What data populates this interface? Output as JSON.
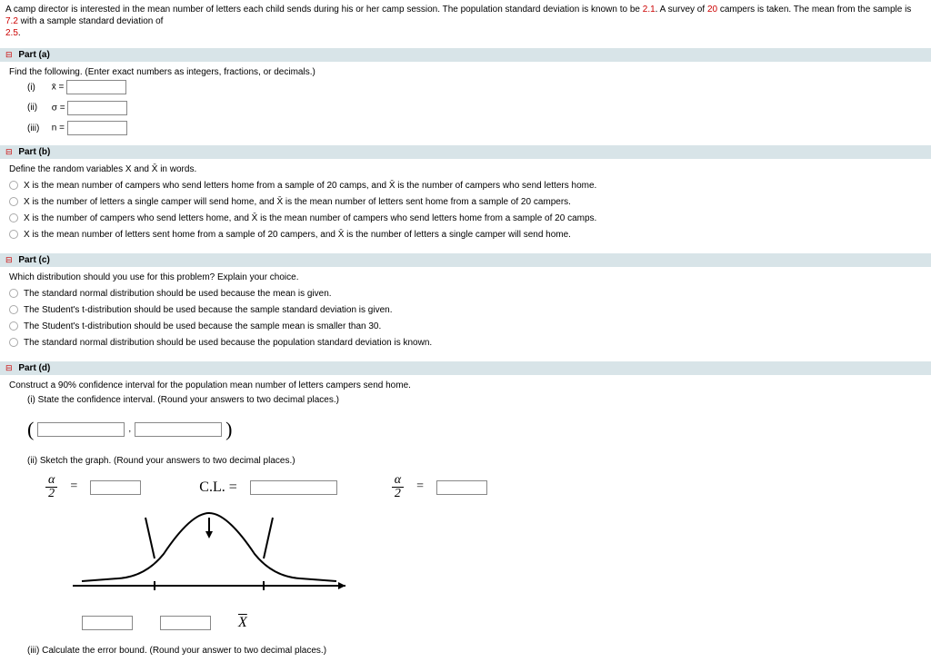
{
  "intro": {
    "text_before": "A camp director is interested in the mean number of letters each child sends during his or her camp session. The population standard deviation is known to be ",
    "sigma": "2.1",
    "text_mid1": ". A survey of ",
    "n": "20",
    "text_mid2": " campers is taken. The mean from the sample is ",
    "xbar": "7.2",
    "text_mid3": " with a sample standard deviation of",
    "s": "2.5",
    "dot": "."
  },
  "partA": {
    "header": "Part (a)",
    "instruction": "Find the following. (Enter exact numbers as integers, fractions, or decimals.)",
    "items": [
      {
        "label": "(i)",
        "sym": "x̄ ="
      },
      {
        "label": "(ii)",
        "sym": "σ ="
      },
      {
        "label": "(iii)",
        "sym": "n ="
      }
    ]
  },
  "partB": {
    "header": "Part (b)",
    "instruction": "Define the random variables X and X̄ in words.",
    "options": [
      "X is the mean number of campers who send letters home from a sample of 20 camps, and X̄ is the number of campers who send letters home.",
      "X is the number of letters a single camper will send home, and X̄ is the mean number of letters sent home from a sample of 20 campers.",
      "X is the number of campers who send letters home, and X̄ is the mean number of campers who send letters home from a sample of 20 camps.",
      "X is the mean number of letters sent home from a sample of 20 campers, and X̄ is the number of letters a single camper will send home."
    ]
  },
  "partC": {
    "header": "Part (c)",
    "instruction": "Which distribution should you use for this problem? Explain your choice.",
    "options": [
      "The standard normal distribution should be used because the mean is given.",
      "The Student's t-distribution should be used because the sample standard deviation is given.",
      "The Student's t-distribution should be used because the sample mean is smaller than 30.",
      "The standard normal distribution should be used because the population standard deviation is known."
    ]
  },
  "partD": {
    "header": "Part (d)",
    "instruction": "Construct a 90% confidence interval for the population mean number of letters campers send home.",
    "sub_i": "(i) State the confidence interval. (Round your answers to two decimal places.)",
    "sub_ii": "(ii) Sketch the graph. (Round your answers to two decimal places.)",
    "sub_iii": "(iii) Calculate the error bound. (Round your answer to two decimal places.)",
    "alpha_num": "α",
    "alpha_den": "2",
    "cl": "C.L. =",
    "xbar_label": "X̄"
  }
}
